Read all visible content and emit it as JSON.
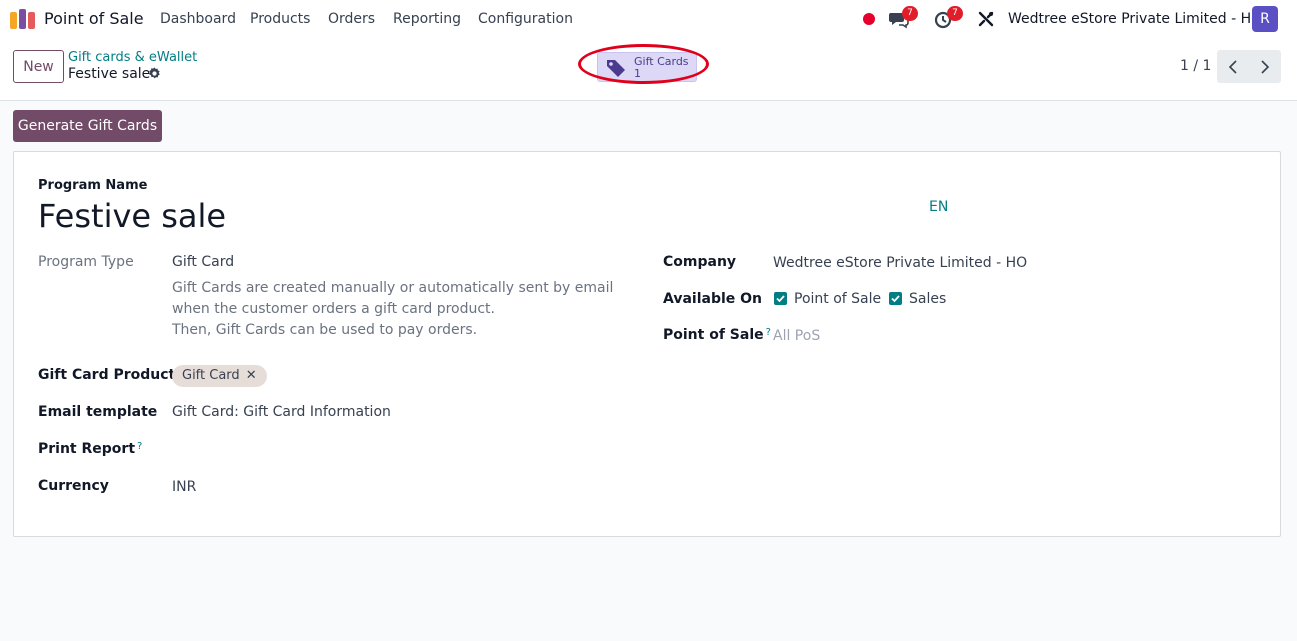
{
  "navbar": {
    "app_name": "Point of Sale",
    "menus": [
      "Dashboard",
      "Products",
      "Orders",
      "Reporting",
      "Configuration"
    ],
    "messages_count": "7",
    "activities_count": "7",
    "company": "Wedtree eStore Private Limited - HO",
    "avatar_initial": "R"
  },
  "control_panel": {
    "new_label": "New",
    "breadcrumb_parent": "Gift cards & eWallet",
    "breadcrumb_current": "Festive sale",
    "smart_button": {
      "label": "Gift Cards",
      "value": "1"
    },
    "pager": "1 / 1"
  },
  "actions": {
    "generate_label": "Generate Gift Cards"
  },
  "form": {
    "program_name_label": "Program Name",
    "program_name": "Festive sale",
    "lang": "EN",
    "program_type_label": "Program Type",
    "program_type": "Gift Card",
    "program_type_desc_1": "Gift Cards are created manually or automatically sent by email when the customer orders a gift card product.",
    "program_type_desc_2": "Then, Gift Cards can be used to pay orders.",
    "gift_card_products_label": "Gift Card Products",
    "gift_card_product_tag": "Gift Card",
    "email_template_label": "Email template",
    "email_template": "Gift Card: Gift Card Information",
    "print_report_label": "Print Report",
    "currency_label": "Currency",
    "currency": "INR",
    "company_label": "Company",
    "company": "Wedtree eStore Private Limited - HO",
    "available_on_label": "Available On",
    "available_on": [
      {
        "label": "Point of Sale",
        "checked": true
      },
      {
        "label": "Sales",
        "checked": true
      }
    ],
    "point_of_sale_label": "Point of Sale",
    "point_of_sale_placeholder": "All PoS",
    "help_mark": "?"
  },
  "colors": {
    "primary": "#714b67",
    "link": "#017e84",
    "smart_button_bg": "#dcd8f6",
    "annotation": "#e0001b",
    "badge": "#e11d2a"
  }
}
